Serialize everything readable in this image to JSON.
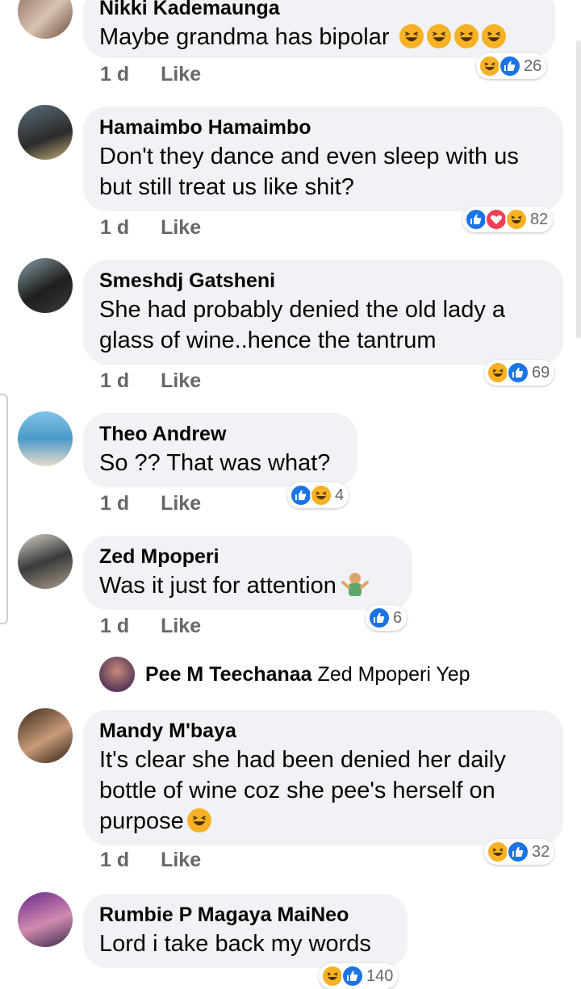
{
  "comments": [
    {
      "name": "Nikki Kademaunga",
      "text": "Maybe grandma has bipolar",
      "time": "1 d",
      "like": "Like",
      "reaction_count": "26",
      "reactions": [
        "haha",
        "like"
      ]
    },
    {
      "name": "Hamaimbo Hamaimbo",
      "text_line1": "Don't they dance and even sleep with us",
      "text_line2": "but still treat us like shit?",
      "time": "1 d",
      "like": "Like",
      "reaction_count": "82",
      "reactions": [
        "like",
        "love",
        "haha"
      ]
    },
    {
      "name": "Smeshdj Gatsheni",
      "text_line1": "She had probably denied the old lady a",
      "text_line2": "glass of wine..hence the tantrum",
      "time": "1 d",
      "like": "Like",
      "reaction_count": "69",
      "reactions": [
        "haha",
        "like"
      ]
    },
    {
      "name": "Theo Andrew",
      "text": "So ?? That was what?",
      "time": "1 d",
      "like": "Like",
      "reaction_count": "4",
      "reactions": [
        "like",
        "haha"
      ]
    },
    {
      "name": "Zed Mpoperi",
      "text": "Was it just for attention",
      "time": "1 d",
      "like": "Like",
      "reaction_count": "6",
      "reactions": [
        "like"
      ]
    },
    {
      "name": "Mandy M'baya",
      "text_line1": "It's clear she had been denied her daily",
      "text_line2": "bottle of wine coz she pee's herself on",
      "text_line3": "purpose",
      "time": "1 d",
      "like": "Like",
      "reaction_count": "32",
      "reactions": [
        "haha",
        "like"
      ]
    },
    {
      "name": "Rumbie P Magaya MaiNeo",
      "text": "Lord i take back my words",
      "reaction_count": "140"
    }
  ],
  "reply": {
    "name": "Pee M Teechanaa",
    "text": "Zed Mpoperi Yep"
  },
  "colors": {
    "like": "#1b74e4",
    "love": "#f33e58",
    "haha": "#f7b125",
    "bubble": "#f0f2f5",
    "meta": "#65676b"
  }
}
